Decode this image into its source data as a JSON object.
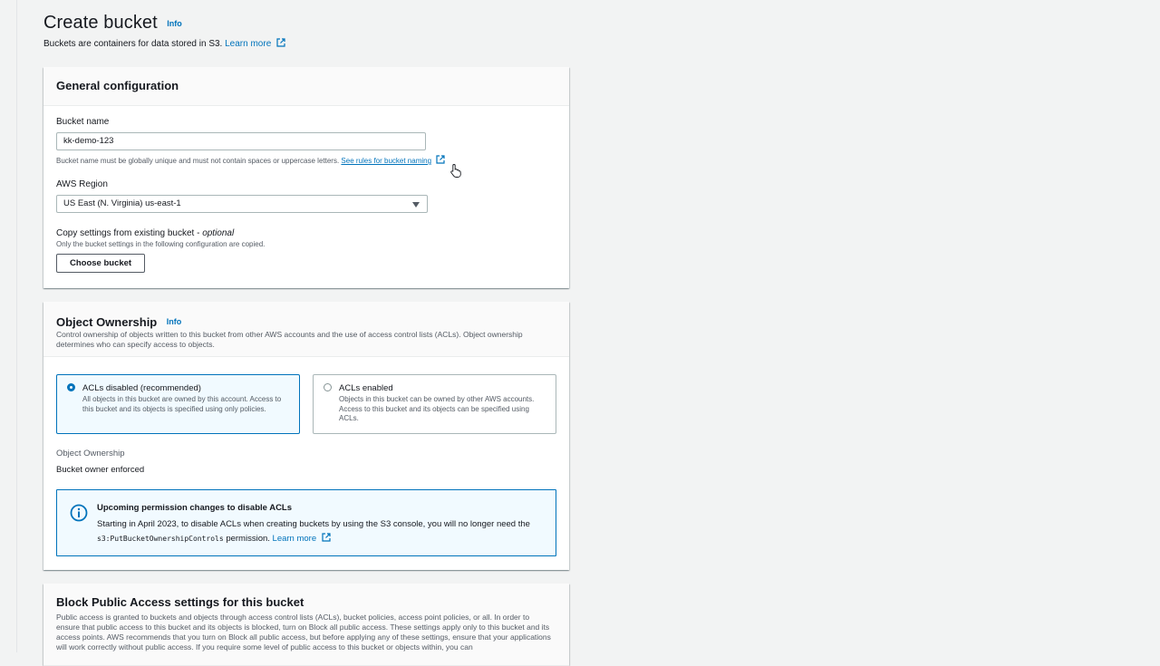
{
  "page": {
    "title": "Create bucket",
    "info_label": "Info",
    "description": "Buckets are containers for data stored in S3.",
    "learn_more": "Learn more"
  },
  "general": {
    "title": "General configuration",
    "bucket_name_label": "Bucket name",
    "bucket_name_value": "kk-demo-123",
    "bucket_name_hint": "Bucket name must be globally unique and must not contain spaces or uppercase letters.",
    "rules_link": "See rules for bucket naming",
    "region_label": "AWS Region",
    "region_value": "US East (N. Virginia) us-east-1",
    "copy_label": "Copy settings from existing bucket - ",
    "copy_optional": "optional",
    "copy_hint": "Only the bucket settings in the following configuration are copied.",
    "choose_button": "Choose bucket"
  },
  "ownership": {
    "title": "Object Ownership",
    "info_label": "Info",
    "description": "Control ownership of objects written to this bucket from other AWS accounts and the use of access control lists (ACLs). Object ownership determines who can specify access to objects.",
    "options": [
      {
        "label": "ACLs disabled (recommended)",
        "desc": "All objects in this bucket are owned by this account. Access to this bucket and its objects is specified using only policies.",
        "selected": true
      },
      {
        "label": "ACLs enabled",
        "desc": "Objects in this bucket can be owned by other AWS accounts. Access to this bucket and its objects can be specified using ACLs.",
        "selected": false
      }
    ],
    "result_label": "Object Ownership",
    "result_value": "Bucket owner enforced",
    "alert": {
      "title": "Upcoming permission changes to disable ACLs",
      "body_1": "Starting in April 2023, to disable ACLs when creating buckets by using the S3 console, you will no longer need the ",
      "code": "s3:PutBucketOwnershipControls",
      "body_2": " permission.",
      "learn_more": "Learn more"
    }
  },
  "block_public": {
    "title": "Block Public Access settings for this bucket",
    "description": "Public access is granted to buckets and objects through access control lists (ACLs), bucket policies, access point policies, or all. In order to ensure that public access to this bucket and its objects is blocked, turn on Block all public access. These settings apply only to this bucket and its access points. AWS recommends that you turn on Block all public access, but before applying any of these settings, ensure that your applications will work correctly without public access. If you require some level of public access to this bucket or objects within, you can"
  },
  "colors": {
    "link": "#0073bb",
    "background": "#f2f3f3",
    "selected_tile": "#f1faff"
  }
}
